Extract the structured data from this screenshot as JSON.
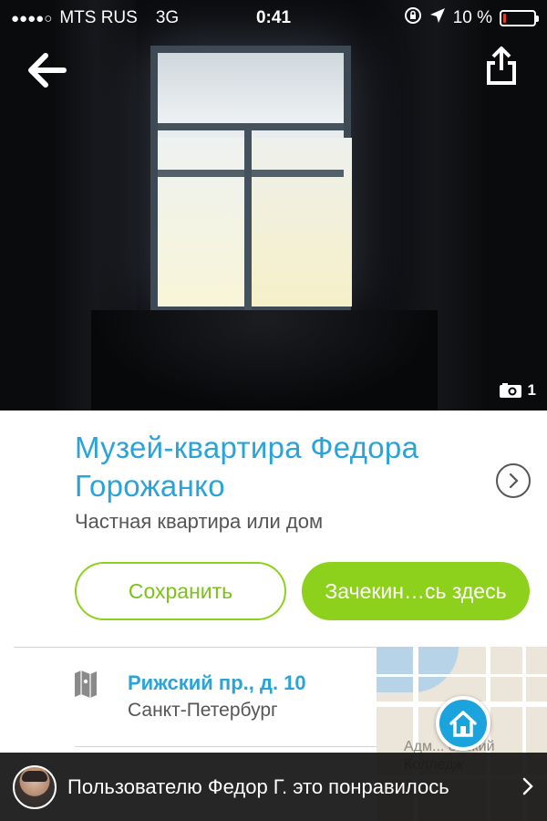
{
  "status_bar": {
    "signal": "●●●●○",
    "carrier": "MTS RUS",
    "network": "3G",
    "time": "0:41",
    "battery_percent": "10 %",
    "battery_level": 0.1,
    "battery_color": "#e53935"
  },
  "hero": {
    "photo_count": "1",
    "back_icon": "arrow-left-icon",
    "share_icon": "share-icon"
  },
  "venue": {
    "name": "Музей-квартира Федора Горожанко",
    "category": "Частная квартира или дом"
  },
  "actions": {
    "save_label": "Сохранить",
    "checkin_label": "Зачекин…сь здесь"
  },
  "location": {
    "address": "Рижский пр., д. 10",
    "city": "Санкт-Петербург",
    "map_label": "Адм... ейский Колледж"
  },
  "social": {
    "text": "Пользователю Федор Г. это понравилось"
  },
  "colors": {
    "accent_blue": "#2aa4d8",
    "accent_green": "#8ed11c"
  }
}
